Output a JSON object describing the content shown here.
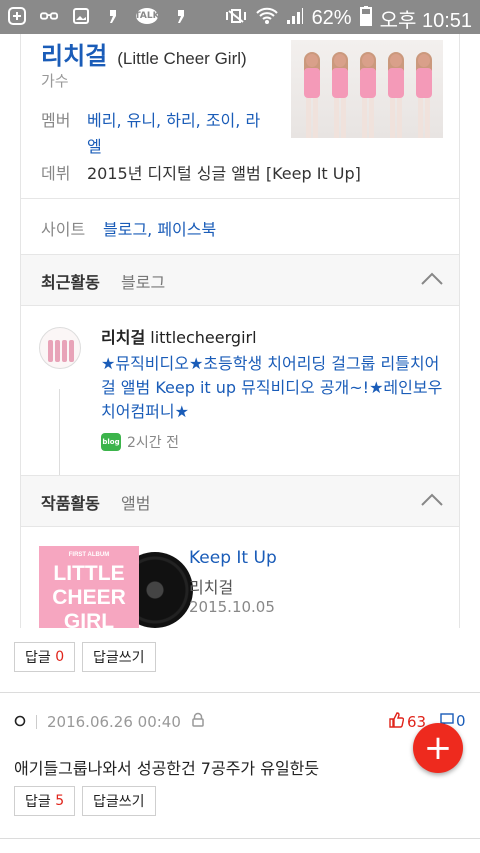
{
  "status_bar": {
    "battery": "62%",
    "time": "오후 10:51",
    "icons": [
      "plus-icon",
      "glasses-icon",
      "image-icon",
      "quote-icon",
      "talk-icon",
      "quote-icon",
      "vibrate-mute-icon",
      "wifi-icon",
      "signal-icon",
      "battery-icon"
    ],
    "talk_text": "TALK"
  },
  "profile": {
    "name": "리치걸",
    "name_en": "(Little Cheer Girl)",
    "job": "가수",
    "member_label": "멤버",
    "members_line1": "베리, 유니, 하리, 조이, 라",
    "members_line2": "엘",
    "debut_label": "데뷔",
    "debut_value": "2015년 디지털 싱글 앨범 [Keep It Up]",
    "site_label": "사이트",
    "site_value": "블로그, 페이스북"
  },
  "recent": {
    "title": "최근활동",
    "sub": "블로그",
    "author_name": "리치걸",
    "author_id": "littlecheergirl",
    "text": "★뮤직비디오★초등학생 치어리딩 걸그룹 리틀치어걸 앨범 Keep it up 뮤직비디오 공개~!★레인보우치어컴퍼니★",
    "blog_icon_text": "blog",
    "time": "2시간 전"
  },
  "works": {
    "title": "작품활동",
    "sub": "앨범",
    "cover_top": "FIRST ALBUM",
    "cover_l1": "LITTLE",
    "cover_l2": "CHEER",
    "cover_l3": "GIRL",
    "album_title": "Keep It Up",
    "album_artist": "리치걸",
    "album_date": "2015.10.05"
  },
  "comment1_actions": {
    "reply_label": "답글",
    "reply_count": "0",
    "write_label": "답글쓰기"
  },
  "comment2": {
    "date": "2016.06.26 00:40",
    "likes": "63",
    "replies": "0",
    "text": "애기들그룹나와서 성공한건 7공주가 유일한듯",
    "reply_label": "답글",
    "reply_count": "5",
    "write_label": "답글쓰기"
  },
  "fab_label": "+"
}
